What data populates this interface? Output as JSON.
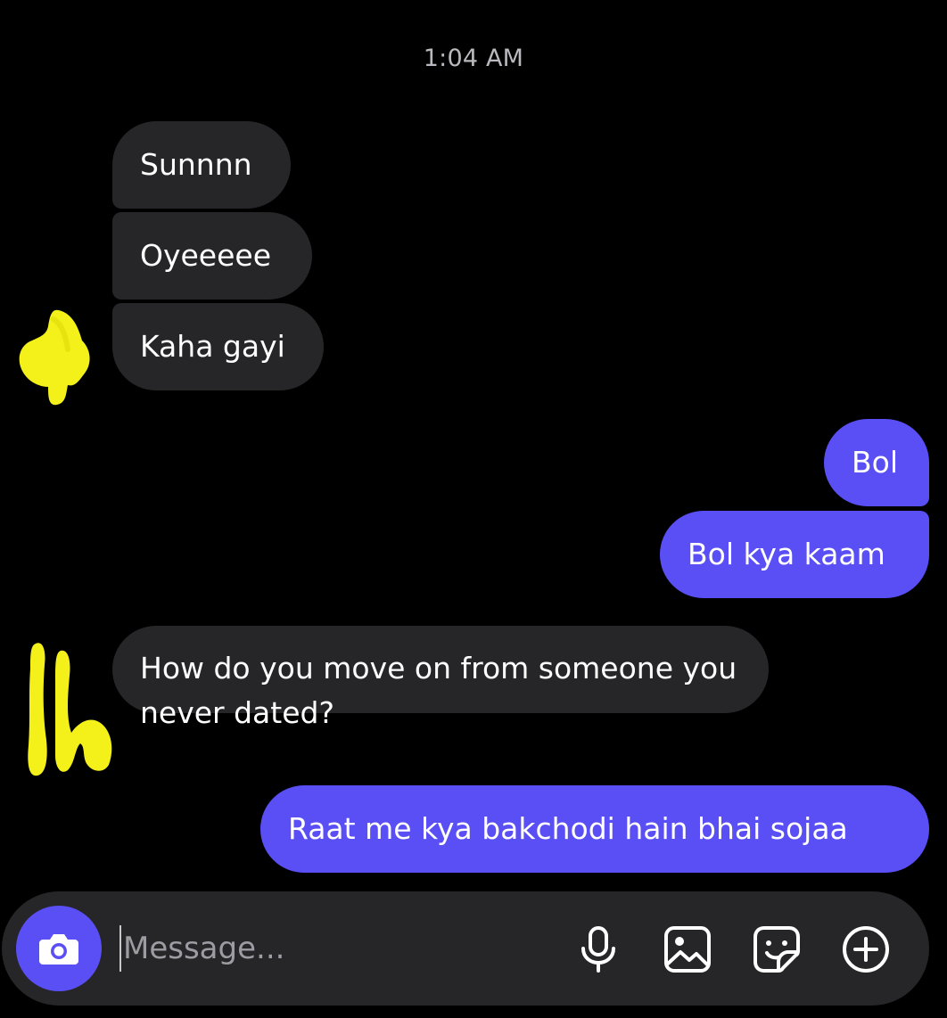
{
  "thread": {
    "timestamp": "1:04 AM",
    "messages": [
      {
        "direction": "incoming",
        "text": "Sunnnn"
      },
      {
        "direction": "incoming",
        "text": "Oyeeeee"
      },
      {
        "direction": "incoming",
        "text": "Kaha gayi"
      },
      {
        "direction": "outgoing",
        "text": "Bol"
      },
      {
        "direction": "outgoing",
        "text": "Bol kya kaam"
      },
      {
        "direction": "incoming",
        "text": "How do you move on from someone you never dated?"
      },
      {
        "direction": "outgoing",
        "text": "Raat me kya bakchodi hain bhai sojaa"
      }
    ]
  },
  "composer": {
    "placeholder": "Message...",
    "value": "",
    "icons": [
      "camera-icon",
      "microphone-icon",
      "gallery-icon",
      "sticker-icon",
      "plus-icon"
    ]
  },
  "colors": {
    "background": "#000000",
    "incoming_bubble": "#262628",
    "outgoing_bubble": "#5a4ff4",
    "redaction": "#f3f01a"
  }
}
